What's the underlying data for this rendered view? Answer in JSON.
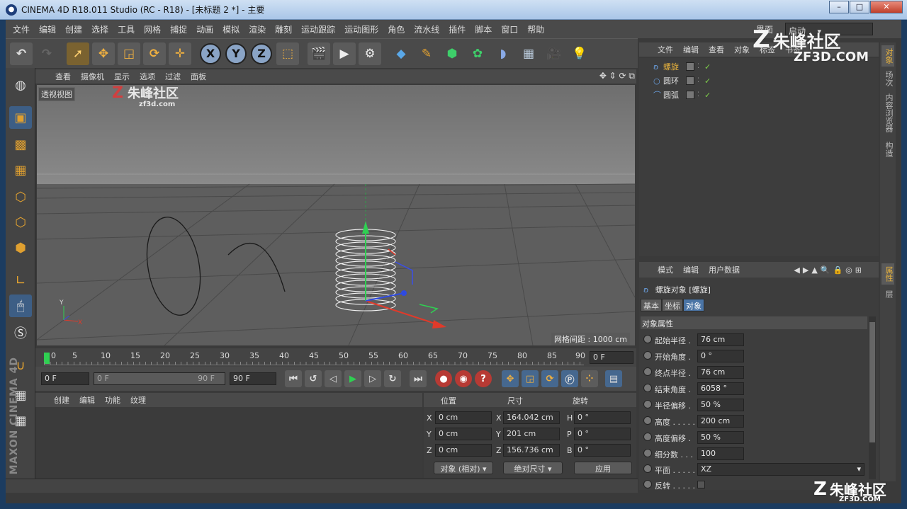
{
  "window": {
    "title": "CINEMA 4D R18.011 Studio (RC - R18) - [未标题 2 *] - 主要"
  },
  "menubar": [
    "文件",
    "编辑",
    "创建",
    "选择",
    "工具",
    "网格",
    "捕捉",
    "动画",
    "模拟",
    "渲染",
    "雕刻",
    "运动跟踪",
    "运动图形",
    "角色",
    "流水线",
    "插件",
    "脚本",
    "窗口",
    "帮助"
  ],
  "layout": {
    "label": "界面",
    "value": "启动"
  },
  "viewport": {
    "menu": [
      "查看",
      "摄像机",
      "显示",
      "选项",
      "过滤",
      "面板"
    ],
    "label": "透视视图",
    "grid_spacing": "网格间距 : 1000 cm"
  },
  "timeline": {
    "ticks": [
      "0",
      "5",
      "10",
      "15",
      "20",
      "25",
      "30",
      "35",
      "40",
      "45",
      "50",
      "55",
      "60",
      "65",
      "70",
      "75",
      "80",
      "85",
      "90"
    ],
    "current_frame": "0 F",
    "start": "0 F",
    "range_start": "0 F",
    "range_end": "90 F",
    "end": "90 F"
  },
  "material": {
    "menu": [
      "创建",
      "编辑",
      "功能",
      "纹理"
    ]
  },
  "coords": {
    "headers": [
      "位置",
      "尺寸",
      "旋转"
    ],
    "pos": [
      {
        "axis": "X",
        "value": "0 cm"
      },
      {
        "axis": "Y",
        "value": "0 cm"
      },
      {
        "axis": "Z",
        "value": "0 cm"
      }
    ],
    "size": [
      {
        "axis": "X",
        "value": "164.042 cm"
      },
      {
        "axis": "Y",
        "value": "201 cm"
      },
      {
        "axis": "Z",
        "value": "156.736 cm"
      }
    ],
    "rot": [
      {
        "axis": "H",
        "value": "0 °"
      },
      {
        "axis": "P",
        "value": "0 °"
      },
      {
        "axis": "B",
        "value": "0 °"
      }
    ],
    "mode": "对象 (相对)",
    "size_mode": "绝对尺寸",
    "apply": "应用"
  },
  "objects": {
    "menu": [
      "文件",
      "编辑",
      "查看",
      "对象",
      "标签",
      "书签"
    ],
    "items": [
      {
        "name": "螺旋",
        "icon": "helix-icon",
        "active": true
      },
      {
        "name": "圆环",
        "icon": "circle-icon",
        "active": false
      },
      {
        "name": "圆弧",
        "icon": "arc-icon",
        "active": false
      }
    ]
  },
  "sidetabs": {
    "top": [
      "对象",
      "场次",
      "内容浏览器",
      "构造"
    ],
    "bottom": [
      "属性",
      "层"
    ]
  },
  "attributes": {
    "menu": [
      "模式",
      "编辑",
      "用户数据"
    ],
    "title": "螺旋对象 [螺旋]",
    "tabs": [
      "基本",
      "坐标",
      "对象"
    ],
    "active_tab": "对象",
    "section": "对象属性",
    "props": [
      {
        "label": "起始半径 .",
        "value": "76 cm"
      },
      {
        "label": "开始角度 .",
        "value": "0 °"
      },
      {
        "label": "终点半径 .",
        "value": "76 cm"
      },
      {
        "label": "结束角度 .",
        "value": "6058 °"
      },
      {
        "label": "半径偏移 .",
        "value": "50 %"
      },
      {
        "label": "高度 . . . . .",
        "value": "200 cm"
      },
      {
        "label": "高度偏移 .",
        "value": "50 %"
      },
      {
        "label": "细分数 . . .",
        "value": "100"
      },
      {
        "label": "平面 . . . . .",
        "value": "XZ"
      },
      {
        "label": "反转 . . . . .",
        "value": ""
      }
    ]
  },
  "watermarks": {
    "brand": "朱峰社区",
    "site1": "zf3d.com",
    "site2": "ZF3D.COM"
  },
  "logo": "MAXON CINEMA 4D",
  "colors": {
    "accent": "#e7b23d",
    "selection": "#4b75a6",
    "green_check": "#7fd24a"
  }
}
